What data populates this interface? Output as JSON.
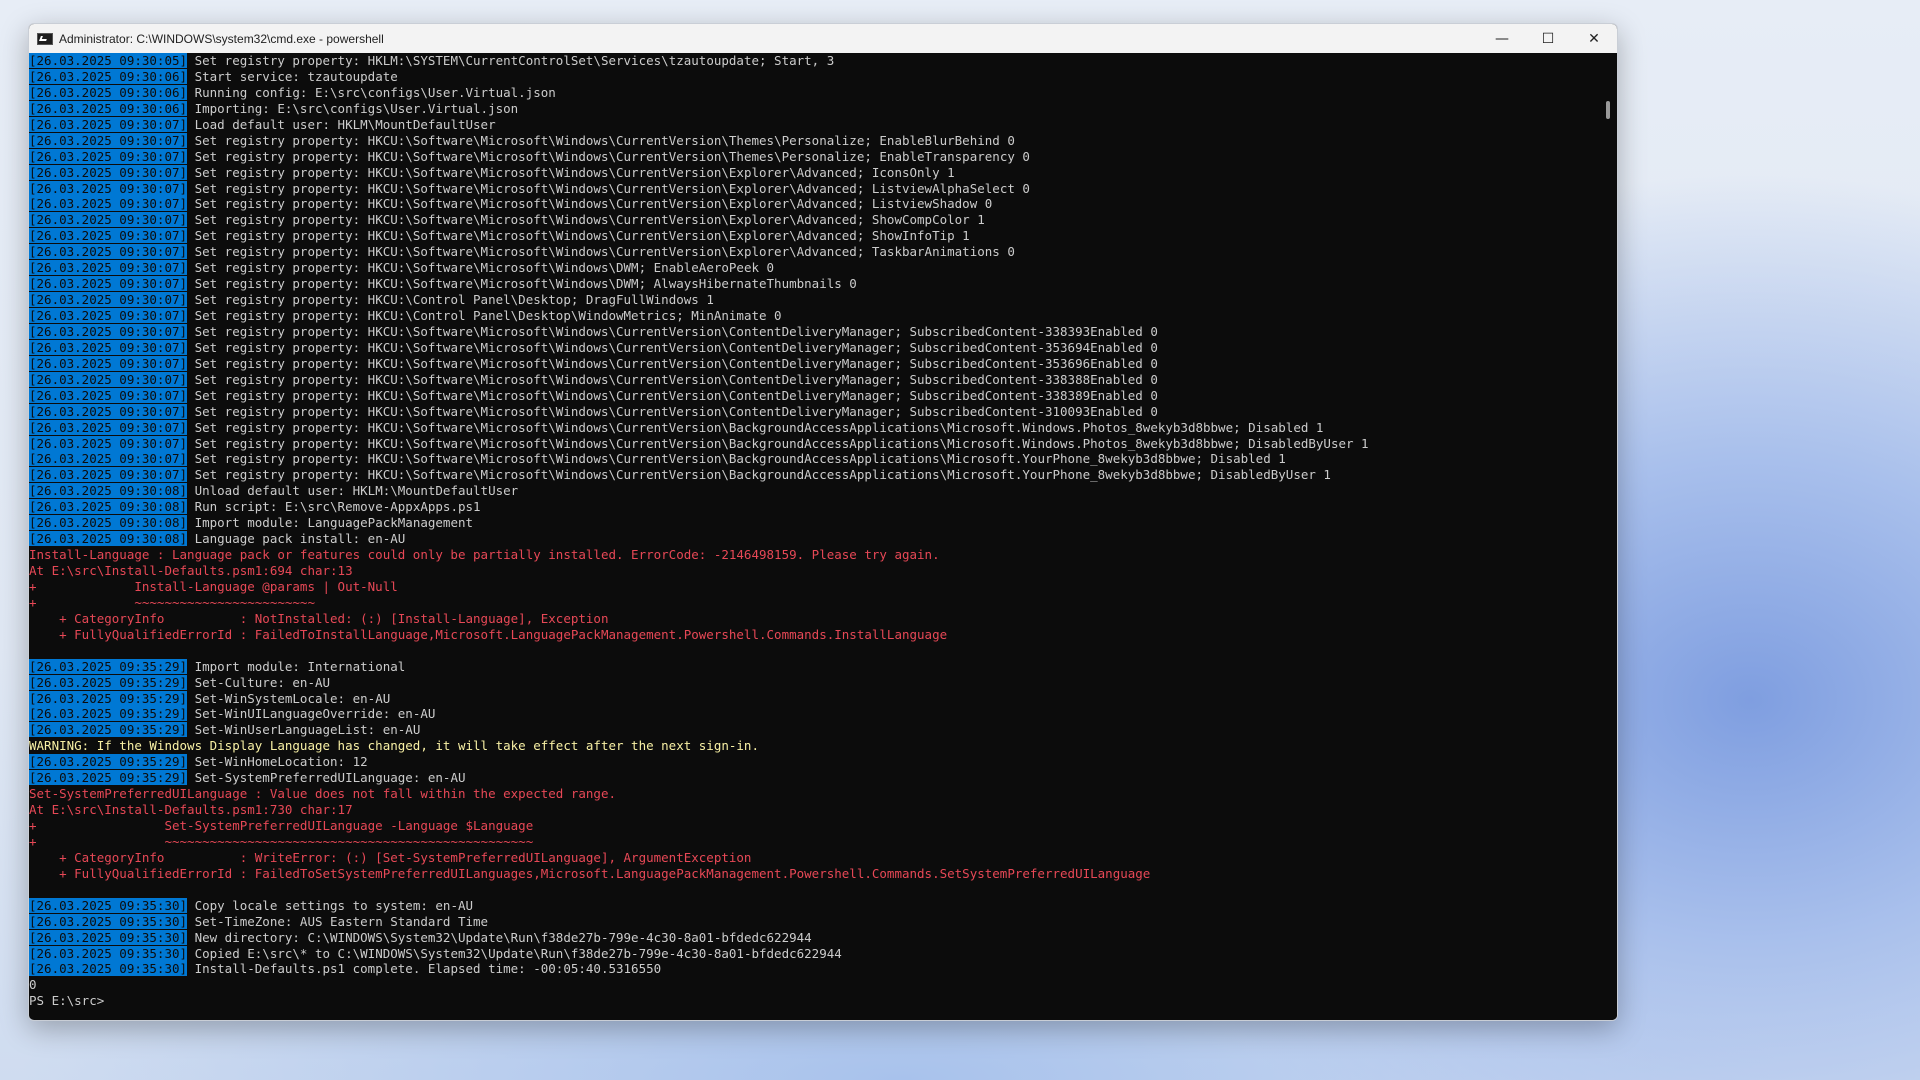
{
  "window": {
    "title": "Administrator: C:\\WINDOWS\\system32\\cmd.exe - powershell",
    "minimize_glyph": "—",
    "maximize_glyph": "☐",
    "close_glyph": "✕",
    "icon": "console-app-icon"
  },
  "colors": {
    "console_bg": "#0c0c0c",
    "text": "#cccccc",
    "timestamp_bg": "#0078d4",
    "error": "#e74856",
    "warning": "#f9f1a5"
  },
  "console_lines": [
    {
      "ts": "[26.03.2025 09:30:05]",
      "text": " Set registry property: HKLM:\\SYSTEM\\CurrentControlSet\\Services\\tzautoupdate; Start, 3"
    },
    {
      "ts": "[26.03.2025 09:30:06]",
      "text": " Start service: tzautoupdate"
    },
    {
      "ts": "[26.03.2025 09:30:06]",
      "text": " Running config: E:\\src\\configs\\User.Virtual.json"
    },
    {
      "ts": "[26.03.2025 09:30:06]",
      "text": " Importing: E:\\src\\configs\\User.Virtual.json"
    },
    {
      "ts": "[26.03.2025 09:30:07]",
      "text": " Load default user: HKLM\\MountDefaultUser"
    },
    {
      "ts": "[26.03.2025 09:30:07]",
      "text": " Set registry property: HKCU:\\Software\\Microsoft\\Windows\\CurrentVersion\\Themes\\Personalize; EnableBlurBehind 0"
    },
    {
      "ts": "[26.03.2025 09:30:07]",
      "text": " Set registry property: HKCU:\\Software\\Microsoft\\Windows\\CurrentVersion\\Themes\\Personalize; EnableTransparency 0"
    },
    {
      "ts": "[26.03.2025 09:30:07]",
      "text": " Set registry property: HKCU:\\Software\\Microsoft\\Windows\\CurrentVersion\\Explorer\\Advanced; IconsOnly 1"
    },
    {
      "ts": "[26.03.2025 09:30:07]",
      "text": " Set registry property: HKCU:\\Software\\Microsoft\\Windows\\CurrentVersion\\Explorer\\Advanced; ListviewAlphaSelect 0"
    },
    {
      "ts": "[26.03.2025 09:30:07]",
      "text": " Set registry property: HKCU:\\Software\\Microsoft\\Windows\\CurrentVersion\\Explorer\\Advanced; ListviewShadow 0"
    },
    {
      "ts": "[26.03.2025 09:30:07]",
      "text": " Set registry property: HKCU:\\Software\\Microsoft\\Windows\\CurrentVersion\\Explorer\\Advanced; ShowCompColor 1"
    },
    {
      "ts": "[26.03.2025 09:30:07]",
      "text": " Set registry property: HKCU:\\Software\\Microsoft\\Windows\\CurrentVersion\\Explorer\\Advanced; ShowInfoTip 1"
    },
    {
      "ts": "[26.03.2025 09:30:07]",
      "text": " Set registry property: HKCU:\\Software\\Microsoft\\Windows\\CurrentVersion\\Explorer\\Advanced; TaskbarAnimations 0"
    },
    {
      "ts": "[26.03.2025 09:30:07]",
      "text": " Set registry property: HKCU:\\Software\\Microsoft\\Windows\\DWM; EnableAeroPeek 0"
    },
    {
      "ts": "[26.03.2025 09:30:07]",
      "text": " Set registry property: HKCU:\\Software\\Microsoft\\Windows\\DWM; AlwaysHibernateThumbnails 0"
    },
    {
      "ts": "[26.03.2025 09:30:07]",
      "text": " Set registry property: HKCU:\\Control Panel\\Desktop; DragFullWindows 1"
    },
    {
      "ts": "[26.03.2025 09:30:07]",
      "text": " Set registry property: HKCU:\\Control Panel\\Desktop\\WindowMetrics; MinAnimate 0"
    },
    {
      "ts": "[26.03.2025 09:30:07]",
      "text": " Set registry property: HKCU:\\Software\\Microsoft\\Windows\\CurrentVersion\\ContentDeliveryManager; SubscribedContent-338393Enabled 0"
    },
    {
      "ts": "[26.03.2025 09:30:07]",
      "text": " Set registry property: HKCU:\\Software\\Microsoft\\Windows\\CurrentVersion\\ContentDeliveryManager; SubscribedContent-353694Enabled 0"
    },
    {
      "ts": "[26.03.2025 09:30:07]",
      "text": " Set registry property: HKCU:\\Software\\Microsoft\\Windows\\CurrentVersion\\ContentDeliveryManager; SubscribedContent-353696Enabled 0"
    },
    {
      "ts": "[26.03.2025 09:30:07]",
      "text": " Set registry property: HKCU:\\Software\\Microsoft\\Windows\\CurrentVersion\\ContentDeliveryManager; SubscribedContent-338388Enabled 0"
    },
    {
      "ts": "[26.03.2025 09:30:07]",
      "text": " Set registry property: HKCU:\\Software\\Microsoft\\Windows\\CurrentVersion\\ContentDeliveryManager; SubscribedContent-338389Enabled 0"
    },
    {
      "ts": "[26.03.2025 09:30:07]",
      "text": " Set registry property: HKCU:\\Software\\Microsoft\\Windows\\CurrentVersion\\ContentDeliveryManager; SubscribedContent-310093Enabled 0"
    },
    {
      "ts": "[26.03.2025 09:30:07]",
      "text": " Set registry property: HKCU:\\Software\\Microsoft\\Windows\\CurrentVersion\\BackgroundAccessApplications\\Microsoft.Windows.Photos_8wekyb3d8bbwe; Disabled 1"
    },
    {
      "ts": "[26.03.2025 09:30:07]",
      "text": " Set registry property: HKCU:\\Software\\Microsoft\\Windows\\CurrentVersion\\BackgroundAccessApplications\\Microsoft.Windows.Photos_8wekyb3d8bbwe; DisabledByUser 1"
    },
    {
      "ts": "[26.03.2025 09:30:07]",
      "text": " Set registry property: HKCU:\\Software\\Microsoft\\Windows\\CurrentVersion\\BackgroundAccessApplications\\Microsoft.YourPhone_8wekyb3d8bbwe; Disabled 1"
    },
    {
      "ts": "[26.03.2025 09:30:07]",
      "text": " Set registry property: HKCU:\\Software\\Microsoft\\Windows\\CurrentVersion\\BackgroundAccessApplications\\Microsoft.YourPhone_8wekyb3d8bbwe; DisabledByUser 1"
    },
    {
      "ts": "[26.03.2025 09:30:08]",
      "text": " Unload default user: HKLM:\\MountDefaultUser"
    },
    {
      "ts": "[26.03.2025 09:30:08]",
      "text": " Run script: E:\\src\\Remove-AppxApps.ps1"
    },
    {
      "ts": "[26.03.2025 09:30:08]",
      "text": " Import module: LanguagePackManagement"
    },
    {
      "ts": "[26.03.2025 09:30:08]",
      "text": " Language pack install: en-AU"
    },
    {
      "kind": "err",
      "text": "Install-Language : Language pack or features could only be partially installed. ErrorCode: -2146498159. Please try again."
    },
    {
      "kind": "err",
      "text": "At E:\\src\\Install-Defaults.psm1:694 char:13"
    },
    {
      "kind": "err",
      "text": "+             Install-Language @params | Out-Null"
    },
    {
      "kind": "err",
      "text": "+             ~~~~~~~~~~~~~~~~~~~~~~~~"
    },
    {
      "kind": "err",
      "text": "    + CategoryInfo          : NotInstalled: (:) [Install-Language], Exception"
    },
    {
      "kind": "err",
      "text": "    + FullyQualifiedErrorId : FailedToInstallLanguage,Microsoft.LanguagePackManagement.Powershell.Commands.InstallLanguage"
    },
    {
      "kind": "blank",
      "text": ""
    },
    {
      "ts": "[26.03.2025 09:35:29]",
      "text": " Import module: International"
    },
    {
      "ts": "[26.03.2025 09:35:29]",
      "text": " Set-Culture: en-AU"
    },
    {
      "ts": "[26.03.2025 09:35:29]",
      "text": " Set-WinSystemLocale: en-AU"
    },
    {
      "ts": "[26.03.2025 09:35:29]",
      "text": " Set-WinUILanguageOverride: en-AU"
    },
    {
      "ts": "[26.03.2025 09:35:29]",
      "text": " Set-WinUserLanguageList: en-AU"
    },
    {
      "kind": "warn",
      "text": "WARNING: If the Windows Display Language has changed, it will take effect after the next sign-in."
    },
    {
      "ts": "[26.03.2025 09:35:29]",
      "text": " Set-WinHomeLocation: 12"
    },
    {
      "ts": "[26.03.2025 09:35:29]",
      "text": " Set-SystemPreferredUILanguage: en-AU"
    },
    {
      "kind": "err",
      "text": "Set-SystemPreferredUILanguage : Value does not fall within the expected range."
    },
    {
      "kind": "err",
      "text": "At E:\\src\\Install-Defaults.psm1:730 char:17"
    },
    {
      "kind": "err",
      "text": "+                 Set-SystemPreferredUILanguage -Language $Language"
    },
    {
      "kind": "err",
      "text": "+                 ~~~~~~~~~~~~~~~~~~~~~~~~~~~~~~~~~~~~~~~~~~~~~~~~~"
    },
    {
      "kind": "err",
      "text": "    + CategoryInfo          : WriteError: (:) [Set-SystemPreferredUILanguage], ArgumentException"
    },
    {
      "kind": "err",
      "text": "    + FullyQualifiedErrorId : FailedToSetSystemPreferredUILanguages,Microsoft.LanguagePackManagement.Powershell.Commands.SetSystemPreferredUILanguage"
    },
    {
      "kind": "blank",
      "text": ""
    },
    {
      "ts": "[26.03.2025 09:35:30]",
      "text": " Copy locale settings to system: en-AU"
    },
    {
      "ts": "[26.03.2025 09:35:30]",
      "text": " Set-TimeZone: AUS Eastern Standard Time"
    },
    {
      "ts": "[26.03.2025 09:35:30]",
      "text": " New directory: C:\\WINDOWS\\System32\\Update\\Run\\f38de27b-799e-4c30-8a01-bfdedc622944"
    },
    {
      "ts": "[26.03.2025 09:35:30]",
      "text": " Copied E:\\src\\* to C:\\WINDOWS\\System32\\Update\\Run\\f38de27b-799e-4c30-8a01-bfdedc622944"
    },
    {
      "ts": "[26.03.2025 09:35:30]",
      "text": " Install-Defaults.ps1 complete. Elapsed time: -00:05:40.5316550"
    },
    {
      "kind": "plain",
      "text": "0"
    },
    {
      "kind": "plain",
      "text": "PS E:\\src> "
    }
  ]
}
